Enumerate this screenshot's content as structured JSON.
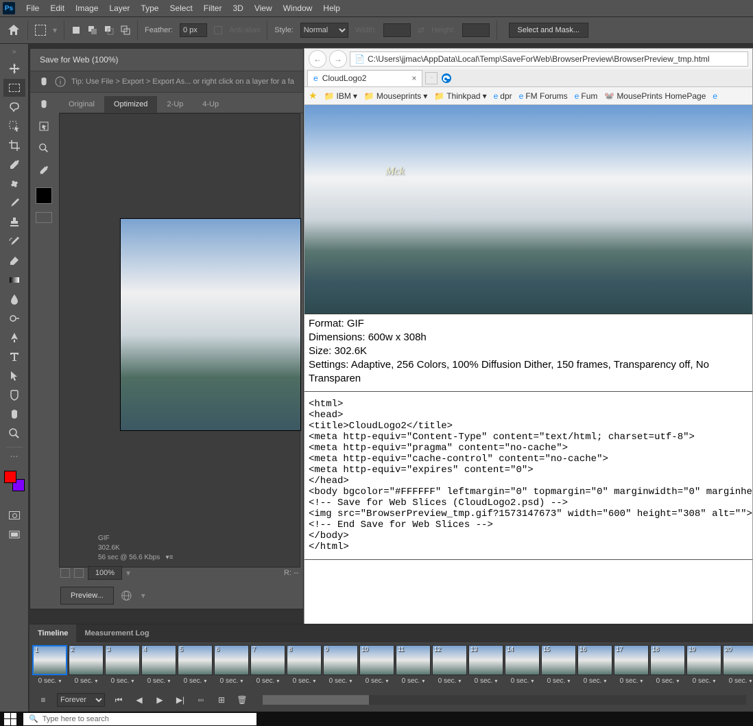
{
  "menubar": {
    "items": [
      "File",
      "Edit",
      "Image",
      "Layer",
      "Type",
      "Select",
      "Filter",
      "3D",
      "View",
      "Window",
      "Help"
    ]
  },
  "optionsbar": {
    "feather_label": "Feather:",
    "feather_value": "0 px",
    "antialias_label": "Anti-alias",
    "style_label": "Style:",
    "style_value": "Normal",
    "width_label": "Width:",
    "height_label": "Height:",
    "action_button": "Select and Mask..."
  },
  "sfw": {
    "title": "Save for Web (100%)",
    "tip": "Tip: Use File > Export > Export As...   or right click on a layer for a fa",
    "tabs": [
      "Original",
      "Optimized",
      "2-Up",
      "4-Up"
    ],
    "active_tab": 1,
    "info_format": "GIF",
    "info_size": "302.6K",
    "info_time": "56 sec @ 56.6 Kbps",
    "zoom": "100%",
    "r_label": "R: --",
    "preview_button": "Preview..."
  },
  "browser": {
    "url": "C:\\Users\\jjmac\\AppData\\Local\\Temp\\SaveForWeb\\BrowserPreview\\BrowserPreview_tmp.html",
    "tab_title": "CloudLogo2",
    "bookmarks": [
      "IBM",
      "Mouseprints",
      "Thinkpad",
      "dpr",
      "FM Forums",
      "Fum",
      "MousePrints HomePage"
    ],
    "signature": "Mck",
    "meta_format": "Format: GIF",
    "meta_dimensions": "Dimensions: 600w x 308h",
    "meta_size": "Size: 302.6K",
    "meta_settings": "Settings: Adaptive, 256 Colors, 100% Diffusion Dither, 150 frames, Transparency off, No Transparen",
    "code": "<html>\n<head>\n<title>CloudLogo2</title>\n<meta http-equiv=\"Content-Type\" content=\"text/html; charset=utf-8\">\n<meta http-equiv=\"pragma\" content=\"no-cache\">\n<meta http-equiv=\"cache-control\" content=\"no-cache\">\n<meta http-equiv=\"expires\" content=\"0\">\n</head>\n<body bgcolor=\"#FFFFFF\" leftmargin=\"0\" topmargin=\"0\" marginwidth=\"0\" marginheight\n<!-- Save for Web Slices (CloudLogo2.psd) -->\n<img src=\"BrowserPreview_tmp.gif?1573147673\" width=\"600\" height=\"308\" alt=\"\">\n<!-- End Save for Web Slices -->\n</body>\n</html>"
  },
  "panels": {
    "tabs": [
      "Timeline",
      "Measurement Log"
    ],
    "active_tab": 0,
    "frame_count": 20,
    "selected_frame": 1,
    "duration": "0 sec.",
    "loop": "Forever"
  },
  "taskbar": {
    "search_placeholder": "Type here to search"
  }
}
